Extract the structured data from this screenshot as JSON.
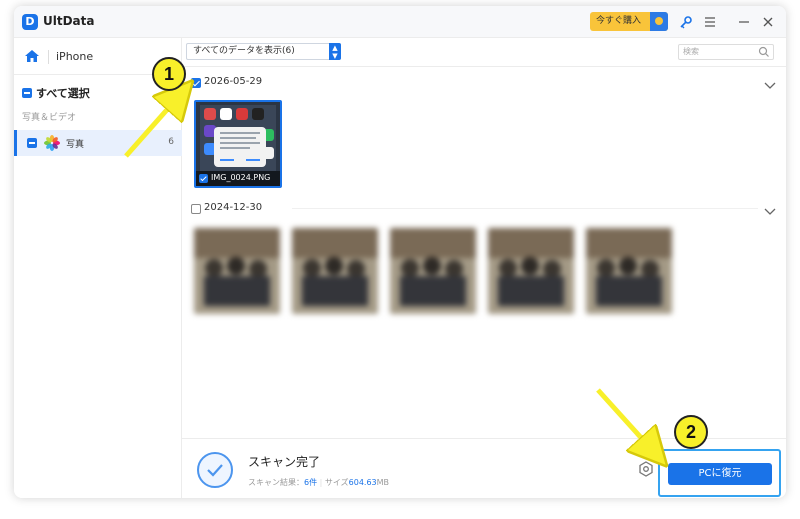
{
  "app": {
    "name": "UltData",
    "buy_label": "今すぐ購入"
  },
  "sidebar": {
    "device": "iPhone",
    "select_all": "すべて選択",
    "section": "写真＆ビデオ",
    "category": {
      "label": "写真",
      "count": "6"
    }
  },
  "main": {
    "filter": "すべてのデータを表示(6)",
    "search_placeholder": "検索",
    "groups": [
      {
        "date": "2026-05-29",
        "checked": true,
        "file": "IMG_0024.PNG"
      },
      {
        "date": "2024-12-30",
        "checked": false
      }
    ]
  },
  "footer": {
    "status": "スキャン完了",
    "result_label": "スキャン結果：",
    "result_value": "6件",
    "size_label": "サイズ",
    "size_value": "604.63",
    "size_unit": "MB",
    "recover_label": "PCに復元"
  },
  "callouts": [
    "1",
    "2"
  ],
  "colors": {
    "accent": "#1a73e8",
    "callout": "#f8f02a",
    "buy": "#f9c43a",
    "highlight": "#35a3f0"
  }
}
